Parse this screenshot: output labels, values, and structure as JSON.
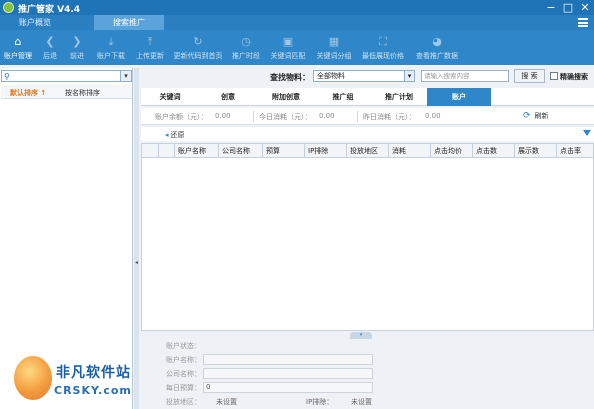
{
  "window": {
    "title": "推广管家 V4.4",
    "controls": {
      "minimize": "−",
      "maximize": "□",
      "close": "✕"
    }
  },
  "top_tabs": [
    {
      "label": "账户概览",
      "active": false
    },
    {
      "label": "搜索推广",
      "active": true
    }
  ],
  "toolbar": {
    "items": [
      {
        "label": "账户管理",
        "icon": "home-icon",
        "enabled": true
      },
      {
        "label": "后退",
        "icon": "arrow-left-icon",
        "enabled": false
      },
      {
        "label": "前进",
        "icon": "arrow-right-icon",
        "enabled": false
      },
      {
        "label": "账户下载",
        "icon": "download-icon",
        "enabled": false
      },
      {
        "label": "上传更新",
        "icon": "upload-icon",
        "enabled": false
      },
      {
        "label": "更新代码到首页",
        "icon": "refresh-icon",
        "enabled": false
      },
      {
        "label": "推广时段",
        "icon": "clock-icon",
        "enabled": false
      },
      {
        "label": "关键词匹配",
        "icon": "image-icon",
        "enabled": false
      },
      {
        "label": "关键词分组",
        "icon": "grid-icon",
        "enabled": false
      },
      {
        "label": "最低展现价格",
        "icon": "expand-icon",
        "enabled": false
      },
      {
        "label": "查看推广数据",
        "icon": "pie-icon",
        "enabled": false
      }
    ]
  },
  "left_panel": {
    "sort_default": "默认排序 ↑",
    "sort_by_name": "按名称排序"
  },
  "search": {
    "find_label": "查找物料：",
    "material_select": "全部物料",
    "keyword_placeholder": "请输入搜索内容",
    "search_button": "搜 索",
    "exact_label": "精确搜索"
  },
  "main_tabs": [
    {
      "label": "关键词",
      "active": false
    },
    {
      "label": "创意",
      "active": false
    },
    {
      "label": "附加创意",
      "active": false
    },
    {
      "label": "推广组",
      "active": false
    },
    {
      "label": "推广计划",
      "active": false
    },
    {
      "label": "账户",
      "active": true
    }
  ],
  "stats": {
    "balance_label": "账户余额（元）：",
    "balance_value": "0.00",
    "today_label": "今日消耗（元）：",
    "today_value": "0.00",
    "yesterday_label": "昨日消耗（元）：",
    "yesterday_value": "0.00",
    "refresh_label": "刷新"
  },
  "back_label": "还原",
  "table": {
    "columns": [
      "账户名称",
      "公司名称",
      "预算",
      "IP排除",
      "投放地区",
      "消耗",
      "点击均价",
      "点击数",
      "展示数",
      "点击率"
    ]
  },
  "detail": {
    "status_label": "账户状态：",
    "name_label": "账户名称：",
    "company_label": "公司名称：",
    "budget_label": "每日预算：",
    "budget_value": "0",
    "region_label": "投放地区：",
    "region_value": "未设置",
    "ip_label": "IP排除：",
    "ip_value": "未设置"
  },
  "watermark": {
    "brand": "非凡软件站",
    "sub": "CRSKY.com"
  }
}
